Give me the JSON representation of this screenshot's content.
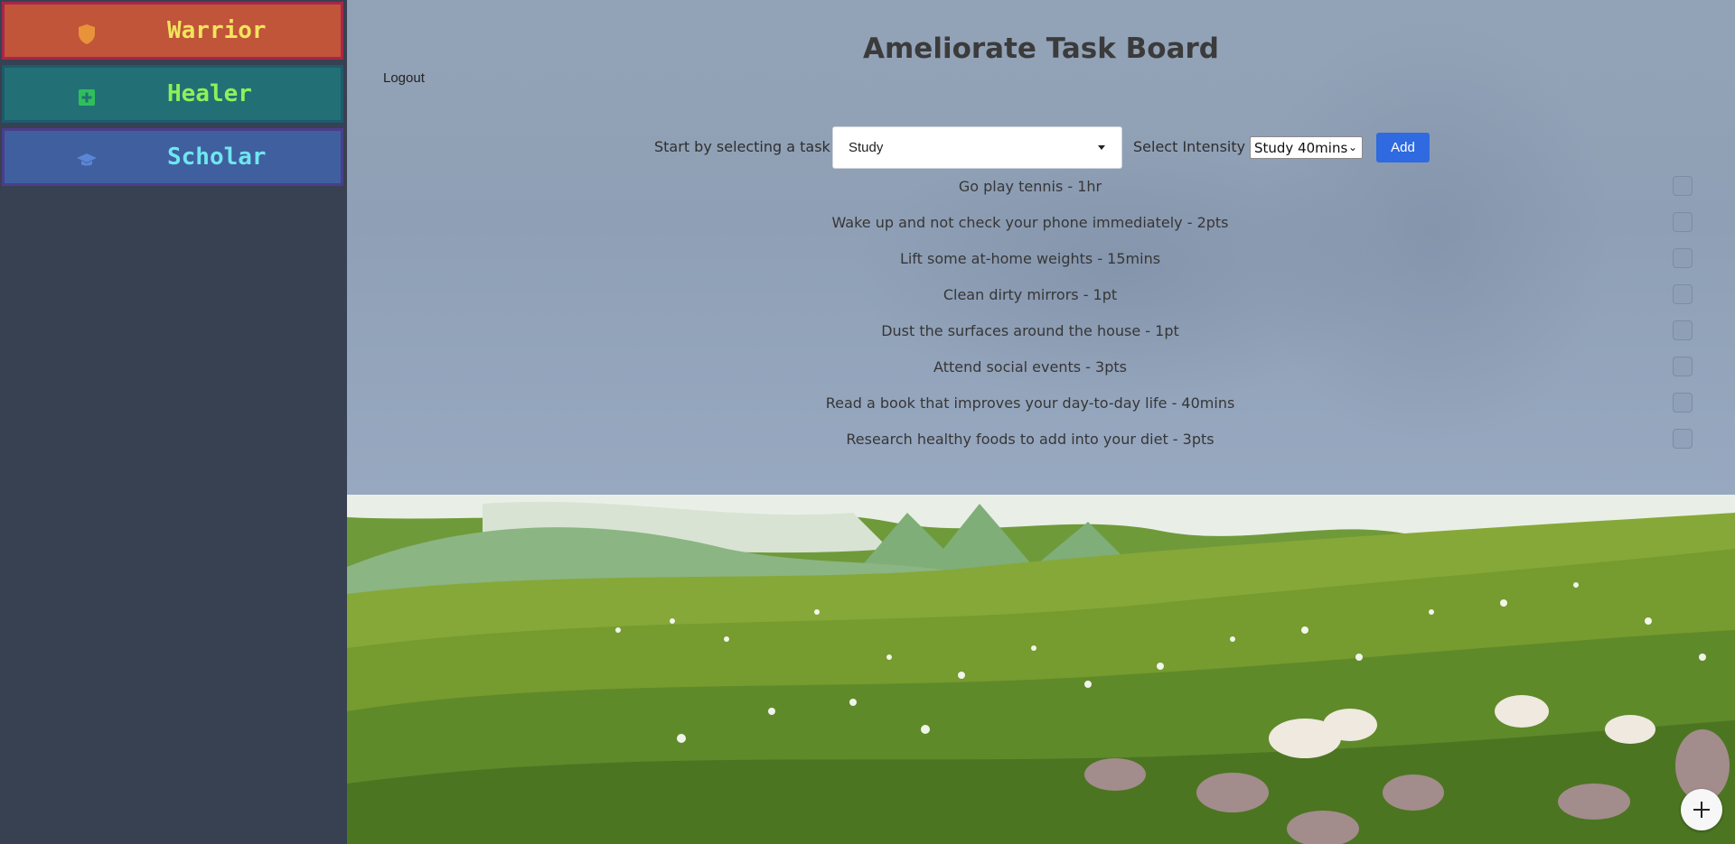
{
  "sidebar": {
    "classes": [
      {
        "label": "Warrior",
        "icon": "shield-icon",
        "label_color": "#f2e45c",
        "icon_color": "#e8923a"
      },
      {
        "label": "Healer",
        "icon": "plus-square-icon",
        "label_color": "#8ef05a",
        "icon_color": "#2fbf5a"
      },
      {
        "label": "Scholar",
        "icon": "graduation-cap-icon",
        "label_color": "#6fe6f0",
        "icon_color": "#5b86d6"
      }
    ]
  },
  "header": {
    "title": "Ameliorate Task Board",
    "logout_label": "Logout"
  },
  "controls": {
    "task_prompt": "Start by selecting a task",
    "task_selected": "Study",
    "intensity_prompt": "Select Intensity",
    "intensity_selected": "Study 40mins",
    "add_label": "Add",
    "accent_color": "#2f6ae0"
  },
  "tasks": [
    {
      "text": "Go play tennis - 1hr",
      "checked": false
    },
    {
      "text": "Wake up and not check your phone immediately - 2pts",
      "checked": false
    },
    {
      "text": "Lift some at-home weights - 15mins",
      "checked": false
    },
    {
      "text": "Clean dirty mirrors - 1pt",
      "checked": false
    },
    {
      "text": "Dust the surfaces around the house - 1pt",
      "checked": false
    },
    {
      "text": "Attend social events - 3pts",
      "checked": false
    },
    {
      "text": "Read a book that improves your day-to-day life - 40mins",
      "checked": false
    },
    {
      "text": "Research healthy foods to add into your diet - 3pts",
      "checked": false
    }
  ],
  "fab": {
    "icon": "plus-icon"
  }
}
